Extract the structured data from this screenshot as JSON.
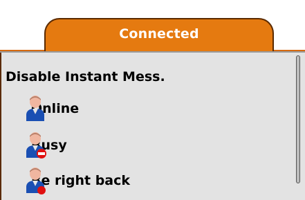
{
  "tab": {
    "label": "Connected"
  },
  "panel": {
    "heading": "Disable Instant Mess.",
    "statuses": [
      {
        "label": "Online",
        "icon": "user-online-icon"
      },
      {
        "label": "Busy",
        "icon": "user-busy-icon"
      },
      {
        "label": "Be right back",
        "icon": "user-brb-icon"
      }
    ]
  },
  "colors": {
    "tab_orange": "#e57a10",
    "badge_red": "#e01010",
    "user_blue": "#1a4fb3"
  }
}
